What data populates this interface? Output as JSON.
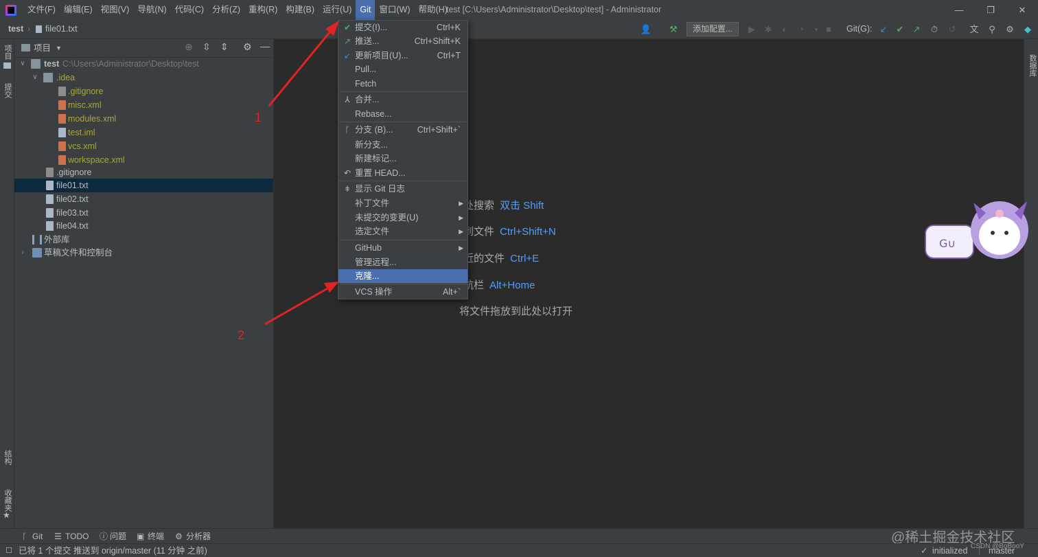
{
  "menubar": {
    "items": [
      "文件(F)",
      "编辑(E)",
      "视图(V)",
      "导航(N)",
      "代码(C)",
      "分析(Z)",
      "重构(R)",
      "构建(B)",
      "运行(U)",
      "Git",
      "窗口(W)",
      "帮助(H)"
    ],
    "active": "Git",
    "window_title": "test [C:\\Users\\Administrator\\Desktop\\test] - Administrator",
    "controls": [
      "—",
      "❐",
      "✕"
    ]
  },
  "navbar": {
    "breadcrumb": [
      "test",
      "file01.txt"
    ],
    "config_button": "添加配置...",
    "git_label": "Git(G):"
  },
  "left_strip": [
    "项目",
    "提交",
    "结构",
    "收藏夹"
  ],
  "right_strip": [
    "数据库"
  ],
  "project_panel": {
    "title": "项目",
    "tree": [
      {
        "label": "test",
        "path": "C:\\Users\\Administrator\\Desktop\\test",
        "icon": "folder",
        "expanded": true
      },
      {
        "label": ".idea",
        "icon": "folder",
        "expanded": true
      },
      {
        "label": ".gitignore",
        "icon": "git-file"
      },
      {
        "label": "misc.xml",
        "icon": "xml-file"
      },
      {
        "label": "modules.xml",
        "icon": "xml-file"
      },
      {
        "label": "test.iml",
        "icon": "file"
      },
      {
        "label": "vcs.xml",
        "icon": "xml-file"
      },
      {
        "label": "workspace.xml",
        "icon": "xml-file"
      },
      {
        "label": ".gitignore",
        "icon": "git-file"
      },
      {
        "label": "file01.txt",
        "icon": "file",
        "selected": true
      },
      {
        "label": "file02.txt",
        "icon": "file"
      },
      {
        "label": "file03.txt",
        "icon": "file"
      },
      {
        "label": "file04.txt",
        "icon": "file"
      },
      {
        "label": "外部库",
        "icon": "library"
      },
      {
        "label": "草稿文件和控制台",
        "icon": "scratch"
      }
    ]
  },
  "git_menu": {
    "items": [
      {
        "icon": "check-icon",
        "label": "提交(I)...",
        "shortcut": "Ctrl+K"
      },
      {
        "icon": "push-icon",
        "label": "推送...",
        "shortcut": "Ctrl+Shift+K"
      },
      {
        "icon": "update-icon",
        "label": "更新项目(U)...",
        "shortcut": "Ctrl+T"
      },
      {
        "label": "Pull..."
      },
      {
        "label": "Fetch"
      },
      {
        "icon": "merge-icon",
        "label": "合并..."
      },
      {
        "label": "Rebase..."
      },
      {
        "icon": "branch-icon",
        "label": "分支 (B)...",
        "shortcut": "Ctrl+Shift+`"
      },
      {
        "label": "新分支..."
      },
      {
        "label": "新建标记..."
      },
      {
        "icon": "reset-icon",
        "label": "重置 HEAD..."
      },
      {
        "icon": "log-icon",
        "label": "显示 Git 日志"
      },
      {
        "label": "补丁文件",
        "submenu": true
      },
      {
        "label": "未提交的变更(U)",
        "submenu": true
      },
      {
        "label": "选定文件",
        "submenu": true
      },
      {
        "label": "GitHub",
        "submenu": true
      },
      {
        "label": "管理远程..."
      },
      {
        "label": "克隆...",
        "highlighted": true
      },
      {
        "label": "VCS 操作",
        "shortcut": "Alt+`"
      }
    ]
  },
  "editor_hints": [
    {
      "text": "随处搜索",
      "key": "双击 Shift"
    },
    {
      "text": "转到文件",
      "key": "Ctrl+Shift+N"
    },
    {
      "text": "最近的文件",
      "key": "Ctrl+E"
    },
    {
      "text": "导航栏",
      "key": "Alt+Home"
    },
    {
      "text": "将文件拖放到此处以打开",
      "key": ""
    }
  ],
  "annotations": [
    "1",
    "2"
  ],
  "bottom_tools": [
    "Git",
    "TODO",
    "问题",
    "终端",
    "分析器"
  ],
  "status": {
    "message": "已将 1 个提交 推送到 origin/master (11 分钟 之前)",
    "right": [
      "initialized",
      "master"
    ]
  },
  "watermark": {
    "main": "@稀土掘金技术社区",
    "small": "CSDN @BoBooY"
  },
  "colors": {
    "accent": "#4b6eaf",
    "hint_key": "#589df6",
    "ignored_file": "#a7a740",
    "annotation": "#e02424"
  }
}
